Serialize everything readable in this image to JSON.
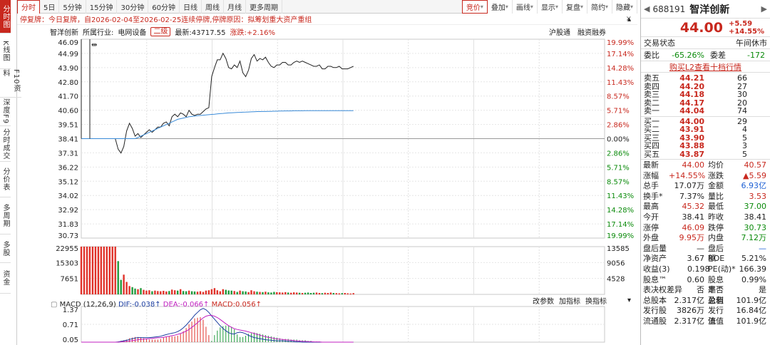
{
  "vtabs": [
    {
      "label": "分时图",
      "active": true
    },
    {
      "label": "K线图"
    },
    {
      "label": "F10资料"
    },
    {
      "label": "深度F9"
    },
    {
      "label": "分时成交"
    },
    {
      "label": "分价表"
    },
    {
      "label": "多周期"
    },
    {
      "label": "多股"
    },
    {
      "label": "资金"
    }
  ],
  "toolbar": {
    "left": [
      "分时",
      "5日",
      "5分钟",
      "15分钟",
      "30分钟",
      "60分钟",
      "日线",
      "周线",
      "月线",
      "更多周期"
    ],
    "right": [
      "竞价",
      "叠加",
      "画线",
      "显示",
      "复盘",
      "简约",
      "隐藏"
    ]
  },
  "notice": {
    "text": "停复牌：今日复牌，自2026-02-04至2026-02-25连续停牌,停牌原因：拟筹划重大资产重组",
    "close": "×"
  },
  "info": {
    "name": "智洋创新",
    "industry_label": "所属行业:",
    "industry": "电网设备",
    "level": "二级",
    "latest_label": "最新:43717.55",
    "change": "涨跌:+2.16%",
    "links": [
      "沪股通",
      "融资融券"
    ]
  },
  "chart_data": {
    "type": "line",
    "price_axis": {
      "ticks_left": [
        "46.09",
        "44.99",
        "43.90",
        "42.80",
        "41.70",
        "40.60",
        "39.51",
        "38.41",
        "37.31",
        "36.22",
        "35.12",
        "34.02",
        "32.92",
        "31.83",
        "30.73"
      ],
      "ticks_right": [
        "19.99%",
        "17.14%",
        "14.28%",
        "11.43%",
        "8.57%",
        "5.71%",
        "2.86%",
        "0.00%",
        "2.86%",
        "5.71%",
        "8.57%",
        "11.43%",
        "14.28%",
        "17.14%",
        "19.99%"
      ],
      "ylim": [
        30.73,
        46.09
      ],
      "prev_close": 38.41
    },
    "series": [
      {
        "values": [
          38.41,
          38.41,
          38.41,
          38.41,
          38.41,
          38.41,
          38.41,
          38.41,
          38.41,
          38.41,
          38.41,
          38.41,
          38.41,
          37.6,
          37.3,
          37.8,
          39.0,
          39.6,
          39.2,
          38.6,
          38.8,
          38.5,
          38.7,
          38.9,
          39.1,
          38.9,
          39.1,
          39.3,
          39.3,
          39.6,
          39.7,
          39.4,
          40.1,
          40.3,
          40.1,
          40.4,
          40.3,
          40.1,
          40.6,
          40.3,
          40.2,
          40.3,
          40.3,
          40.5,
          40.7,
          40.8,
          43.2,
          43.9,
          44.5,
          44.5,
          45.0,
          44.6,
          43.9,
          43.8,
          44.1,
          43.9,
          44.4,
          43.5,
          43.2,
          43.7,
          44.6,
          44.9,
          44.4,
          44.6,
          44.5,
          44.7,
          44.3,
          44.0,
          43.9,
          44.1,
          44.1,
          44.3,
          44.3,
          44.1,
          44.1,
          44.3,
          44.4,
          44.3,
          44.4,
          44.3,
          44.2,
          44.1,
          44.0,
          44.0,
          44.1,
          43.8,
          43.8,
          44.0,
          44.0,
          43.9,
          43.9,
          44.0,
          43.8,
          43.8,
          43.8,
          43.9,
          44.0
        ]
      },
      {
        "values": [
          38.41,
          38.41,
          38.41,
          38.41,
          38.41,
          38.41,
          38.41,
          38.41,
          38.41,
          38.41,
          38.41,
          38.41,
          38.41,
          38.41,
          38.41,
          38.41,
          38.41,
          38.41,
          38.41,
          38.41,
          38.5,
          38.6,
          38.7,
          38.8,
          38.9,
          39.0,
          39.1,
          39.2,
          39.3,
          39.4,
          39.5,
          39.6,
          39.7,
          39.8,
          39.9,
          39.95,
          40.0,
          40.05,
          40.1,
          40.12,
          40.15,
          40.18,
          40.2,
          40.22,
          40.24,
          40.26,
          40.28,
          40.3,
          40.32,
          40.34,
          40.36,
          40.38,
          40.4,
          40.41,
          40.42,
          40.43,
          40.44,
          40.45,
          40.46,
          40.47,
          40.48,
          40.49,
          40.5,
          40.5,
          40.51,
          40.51,
          40.52,
          40.52,
          40.53,
          40.53,
          40.54,
          40.54,
          40.55,
          40.55,
          40.55,
          40.56,
          40.56,
          40.56,
          40.56,
          40.57,
          40.57,
          40.57,
          40.57,
          40.57,
          40.57,
          40.57,
          40.57,
          40.57,
          40.57,
          40.57,
          40.57,
          40.57,
          40.57,
          40.57,
          40.57,
          40.57,
          40.57
        ]
      }
    ],
    "volume_axis": {
      "ticks_left": [
        "22955",
        "15303",
        "7651"
      ],
      "ticks_right": [
        "13585",
        "9056",
        "4528"
      ],
      "ymax": 22955
    },
    "volume": [
      22955,
      22955,
      22955,
      22955,
      22955,
      22955,
      22955,
      22955,
      22955,
      22955,
      22955,
      22955,
      22955,
      16000,
      7000,
      9500,
      6000,
      4000,
      3500,
      2800,
      2500,
      3000,
      2200,
      1800,
      2000,
      1500,
      1800,
      1600,
      1500,
      1700,
      1400,
      1600,
      2300,
      2000,
      1800,
      2500,
      1600,
      1500,
      1800,
      1500,
      1400,
      1300,
      1500,
      1200,
      1800,
      2000,
      2500,
      3000,
      2000,
      1500,
      2500,
      2200,
      1900,
      1800,
      1600,
      1200,
      1800,
      1500,
      1400,
      1100,
      2000,
      1500,
      1300,
      1200,
      1100,
      1300,
      1000,
      900,
      1200,
      1100,
      1000,
      900,
      1100,
      900,
      800,
      1000,
      900,
      800,
      700,
      800,
      900,
      700,
      800,
      900,
      700,
      600,
      800,
      700,
      900,
      700,
      600,
      500,
      600,
      700,
      500,
      400,
      600
    ],
    "volume_tabs": [
      "改参数",
      "加指标",
      "换指标"
    ],
    "macd": {
      "title": "MACD (12,26,9)",
      "dif": "DIF:-0.038↑",
      "dea": "DEA:-0.066↑",
      "macd": "MACD:0.056↑",
      "ticks_left": [
        "1.37",
        "0.71",
        "0.05"
      ],
      "ylim": [
        0.05,
        1.37
      ],
      "dif_values": [
        0.05,
        0.05,
        0.05,
        0.05,
        0.05,
        0.05,
        0.05,
        0.05,
        0.05,
        0.05,
        0.05,
        0.05,
        0.05,
        0.06,
        0.08,
        0.1,
        0.12,
        0.15,
        0.18,
        0.2,
        0.22,
        0.22,
        0.22,
        0.22,
        0.22,
        0.23,
        0.24,
        0.25,
        0.27,
        0.3,
        0.33,
        0.36,
        0.38,
        0.4,
        0.44,
        0.5,
        0.58,
        0.68,
        0.8,
        0.92,
        1.05,
        1.15,
        1.25,
        1.3,
        1.25,
        1.15,
        1.02,
        0.9,
        0.78,
        0.66,
        0.56,
        0.47,
        0.4,
        0.36,
        0.35,
        0.4,
        0.42,
        0.4,
        0.36,
        0.3,
        0.26,
        0.22,
        0.2,
        0.18,
        0.16,
        0.14,
        0.13,
        0.12,
        0.11,
        0.1,
        0.1,
        0.1,
        0.09,
        0.08,
        0.08,
        0.07,
        0.06,
        0.06,
        0.05,
        0.05,
        0.05,
        0.05,
        0.05,
        0.05,
        0.05,
        0.05,
        0.05,
        0.05,
        0.05,
        0.05,
        0.05,
        0.05,
        0.05,
        0.05,
        0.05,
        0.05,
        0.05
      ],
      "dea_values": [
        0.05,
        0.05,
        0.05,
        0.05,
        0.05,
        0.05,
        0.05,
        0.05,
        0.05,
        0.05,
        0.05,
        0.05,
        0.05,
        0.05,
        0.06,
        0.07,
        0.08,
        0.09,
        0.11,
        0.12,
        0.14,
        0.15,
        0.16,
        0.17,
        0.18,
        0.19,
        0.2,
        0.21,
        0.22,
        0.23,
        0.25,
        0.27,
        0.29,
        0.31,
        0.34,
        0.37,
        0.41,
        0.46,
        0.52,
        0.6,
        0.68,
        0.77,
        0.86,
        0.95,
        1.01,
        1.04,
        1.04,
        1.01,
        0.96,
        0.89,
        0.81,
        0.73,
        0.66,
        0.6,
        0.55,
        0.52,
        0.5,
        0.48,
        0.46,
        0.43,
        0.4,
        0.37,
        0.34,
        0.31,
        0.28,
        0.25,
        0.23,
        0.21,
        0.19,
        0.17,
        0.16,
        0.15,
        0.14,
        0.13,
        0.12,
        0.11,
        0.1,
        0.09,
        0.08,
        0.08,
        0.07,
        0.07,
        0.06,
        0.06,
        0.06,
        0.05,
        0.05,
        0.05,
        0.05,
        0.05,
        0.05,
        0.05,
        0.05,
        0.05,
        0.05,
        0.05,
        0.05
      ]
    }
  },
  "rp": {
    "code": "688191",
    "name": "智洋创新",
    "price": "44.00",
    "chg": "+5.59",
    "pct": "+14.55%",
    "status_label": "交易状态",
    "status": "午间休市",
    "wb_label": "委比",
    "wb": "-65.26%",
    "wc_label": "委差",
    "wc": "-172",
    "buy_link": "购买L2查看十档行情",
    "asks": [
      {
        "l": "卖五",
        "p": "44.21",
        "v": "66"
      },
      {
        "l": "卖四",
        "p": "44.20",
        "v": "27"
      },
      {
        "l": "卖三",
        "p": "44.18",
        "v": "30"
      },
      {
        "l": "卖二",
        "p": "44.17",
        "v": "20"
      },
      {
        "l": "卖一",
        "p": "44.04",
        "v": "74"
      }
    ],
    "bids": [
      {
        "l": "买一",
        "p": "44.00",
        "v": "29"
      },
      {
        "l": "买二",
        "p": "43.91",
        "v": "4"
      },
      {
        "l": "买三",
        "p": "43.90",
        "v": "5"
      },
      {
        "l": "买四",
        "p": "43.88",
        "v": "3"
      },
      {
        "l": "买五",
        "p": "43.87",
        "v": "5"
      }
    ],
    "stats": [
      {
        "k1": "最新",
        "v1": "44.00",
        "c1": "red",
        "k2": "均价",
        "v2": "40.57",
        "c2": "red"
      },
      {
        "k1": "涨幅",
        "v1": "+14.55%",
        "c1": "red",
        "k2": "涨跌",
        "v2": "▲5.59",
        "c2": "red"
      },
      {
        "k1": "总手",
        "v1": "17.07万",
        "c1": "",
        "k2": "金额",
        "v2": "6.93亿",
        "c2": "blue"
      },
      {
        "k1": "换手*",
        "v1": "7.37%",
        "c1": "",
        "k2": "量比",
        "v2": "3.53",
        "c2": "red"
      },
      {
        "k1": "最高",
        "v1": "45.32",
        "c1": "red",
        "k2": "最低",
        "v2": "37.00",
        "c2": "green"
      },
      {
        "k1": "今开",
        "v1": "38.41",
        "c1": "",
        "k2": "昨收",
        "v2": "38.41",
        "c2": ""
      },
      {
        "k1": "涨停",
        "v1": "46.09",
        "c1": "red",
        "k2": "跌停",
        "v2": "30.73",
        "c2": "green"
      },
      {
        "k1": "外盘",
        "v1": "9.95万",
        "c1": "red",
        "k2": "内盘",
        "v2": "7.12万",
        "c2": "green"
      },
      {
        "k1": "盘后量",
        "v1": "—",
        "c1": "",
        "k2": "盘后额",
        "v2": "—",
        "c2": "blue"
      },
      {
        "k1": "净资产",
        "v1": "3.67",
        "c1": "",
        "k2": "ROE",
        "v2": "5.21%",
        "c2": ""
      },
      {
        "k1": "收益(3)",
        "v1": "0.198",
        "c1": "",
        "k2": "PE(动)*",
        "v2": "166.39",
        "c2": ""
      },
      {
        "k1": "股息™",
        "v1": "0.60",
        "c1": "",
        "k2": "股息率™",
        "v2": "0.99%",
        "c2": ""
      },
      {
        "k1": "表决权差异",
        "v1": "否",
        "c1": "",
        "k2": "是否盈利",
        "v2": "是",
        "c2": ""
      },
      {
        "k1": "总股本",
        "v1": "2.317亿",
        "c1": "",
        "k2": "总值",
        "v2": "101.9亿",
        "c2": ""
      },
      {
        "k1": "发行股",
        "v1": "3826万",
        "c1": "",
        "k2": "发行值",
        "v2": "16.84亿",
        "c2": ""
      },
      {
        "k1": "流通股",
        "v1": "2.317亿",
        "c1": "",
        "k2": "流值",
        "v2": "101.9亿",
        "c2": ""
      }
    ]
  }
}
